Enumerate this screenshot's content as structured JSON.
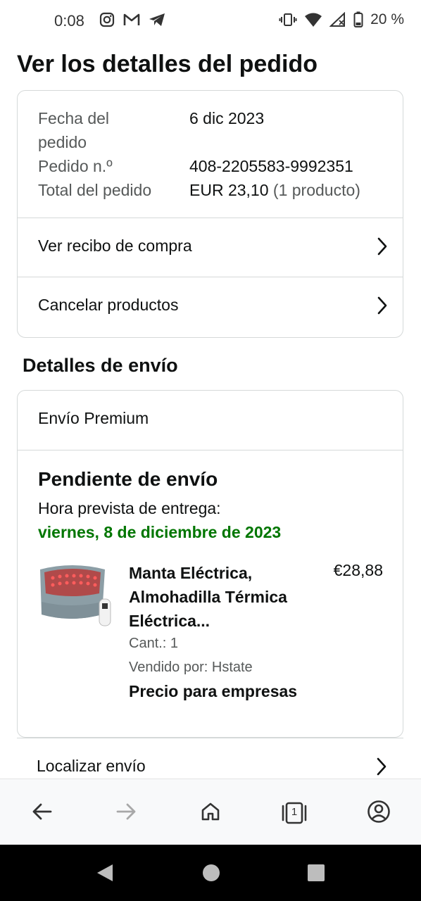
{
  "status_bar": {
    "time": "0:08",
    "battery": "20 %",
    "icons": [
      "instagram-icon",
      "gmail-icon",
      "telegram-icon",
      "vibrate-icon",
      "wifi-icon",
      "signal-icon",
      "battery-icon"
    ]
  },
  "page": {
    "title": "Ver los detalles del pedido"
  },
  "order_info": {
    "date_label": "Fecha del pedido",
    "date_value": "6 dic 2023",
    "number_label": "Pedido n.º",
    "number_value": "408-2205583-9992351",
    "total_label": "Total del pedido",
    "total_value": "EUR 23,10",
    "total_count": "(1 producto)"
  },
  "links": {
    "receipt": "Ver recibo de compra",
    "cancel": "Cancelar productos"
  },
  "shipping": {
    "section_title": "Detalles de envío",
    "type": "Envío Premium",
    "status": "Pendiente de envío",
    "eta_label": "Hora prevista de entrega:",
    "eta_date": "viernes, 8 de diciembre de 2023",
    "track_label": "Localizar envío"
  },
  "product": {
    "title": "Manta Eléctrica, Almohadilla Térmica Eléctrica...",
    "price": "€28,88",
    "quantity": "Cant.: 1",
    "seller": "Vendido por: Hstate",
    "business_price": "Precio para empresas"
  },
  "toolbar": {
    "tab_count": "1",
    "icons": [
      "back-arrow-icon",
      "forward-arrow-icon",
      "home-icon",
      "tabs-icon",
      "account-icon"
    ]
  },
  "colors": {
    "accent_green": "#007600",
    "border": "#d5d9d9",
    "text": "#0f1111",
    "muted": "#565959"
  }
}
